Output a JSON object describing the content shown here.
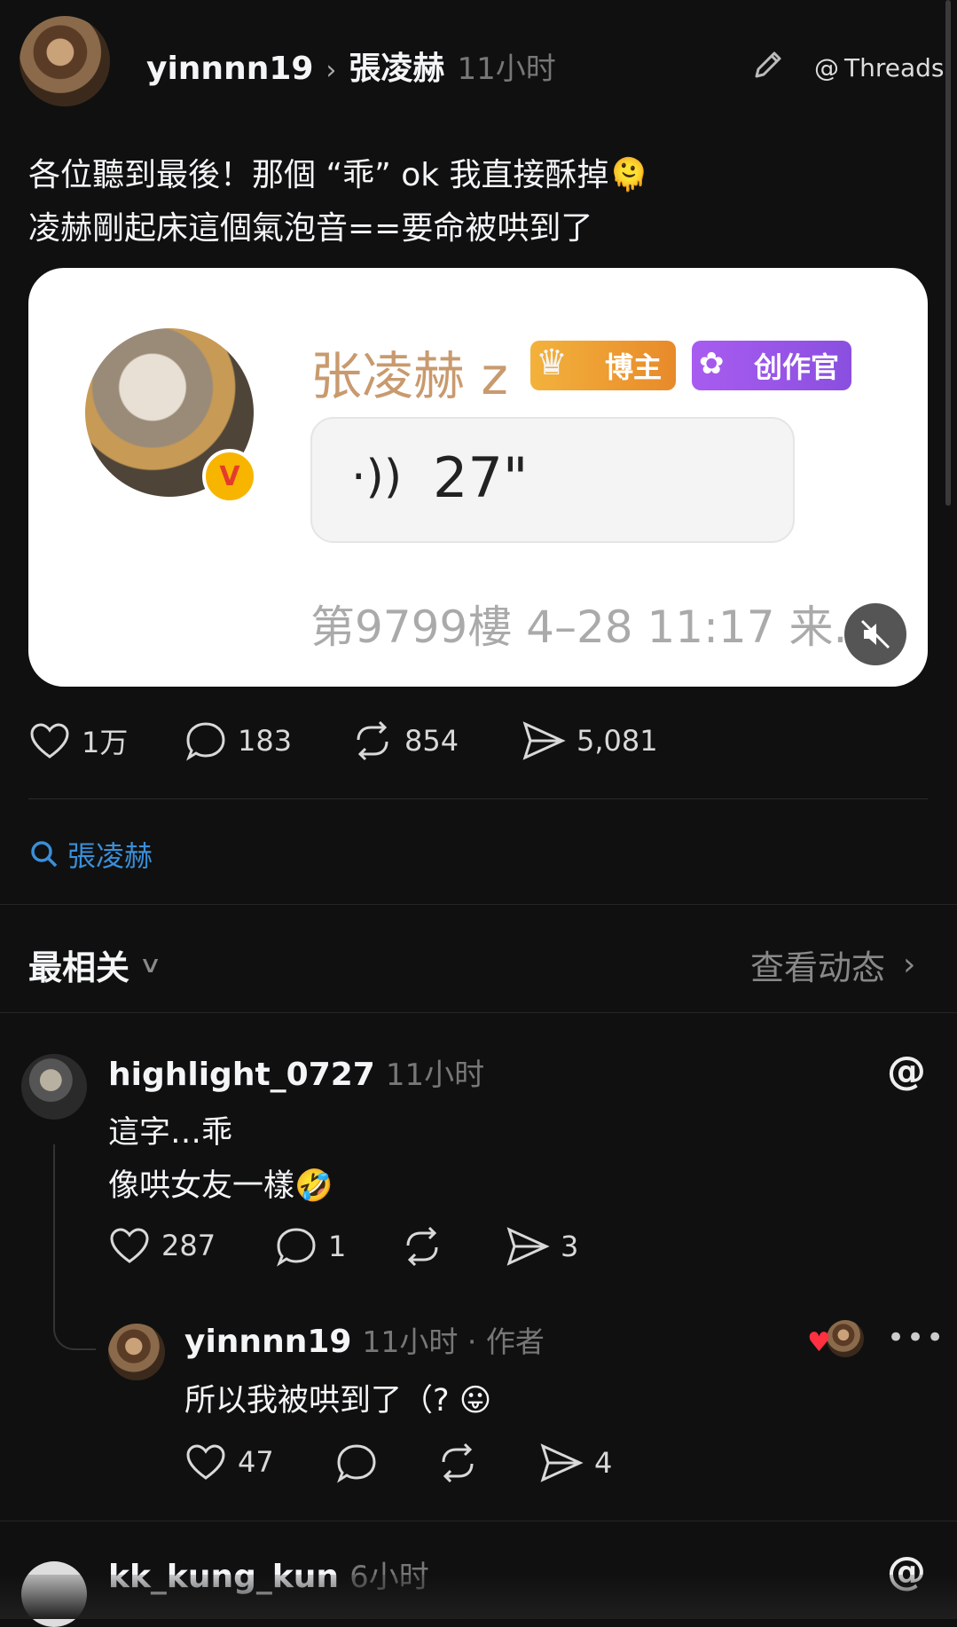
{
  "post": {
    "username": "yinnnn19",
    "reply_to": "張凌赫",
    "time": "11小时",
    "threads_label": "Threads",
    "text_line1": "各位聽到最後！那個 “乖” ok 我直接酥掉🫠",
    "text_line2": "凌赫剛起床這個氣泡音==要命被哄到了",
    "media": {
      "name": "张凌赫 z",
      "badge1": "博主",
      "badge2": "创作官",
      "audio_duration": "27\"",
      "footer": "第9799樓 4–28 11:17 来."
    },
    "stats": {
      "likes": "1万",
      "comments": "183",
      "reposts": "854",
      "shares": "5,081"
    },
    "topic": "張凌赫"
  },
  "sort": {
    "label": "最相关",
    "view_activity": "查看动态"
  },
  "replies": [
    {
      "username": "highlight_0727",
      "time": "11小时",
      "line1": "這字…乖",
      "line2": "像哄女友一樣🤣",
      "likes": "287",
      "comments": "1",
      "shares": "3"
    },
    {
      "username": "yinnnn19",
      "time": "11小时 · 作者",
      "text": "所以我被哄到了（?  😛",
      "likes": "47",
      "shares": "4"
    },
    {
      "username": "kk_kung_kun",
      "time": "6小时"
    }
  ],
  "colors": {
    "background": "#101010",
    "link": "#3a8fd9",
    "heart": "#ff3040"
  }
}
